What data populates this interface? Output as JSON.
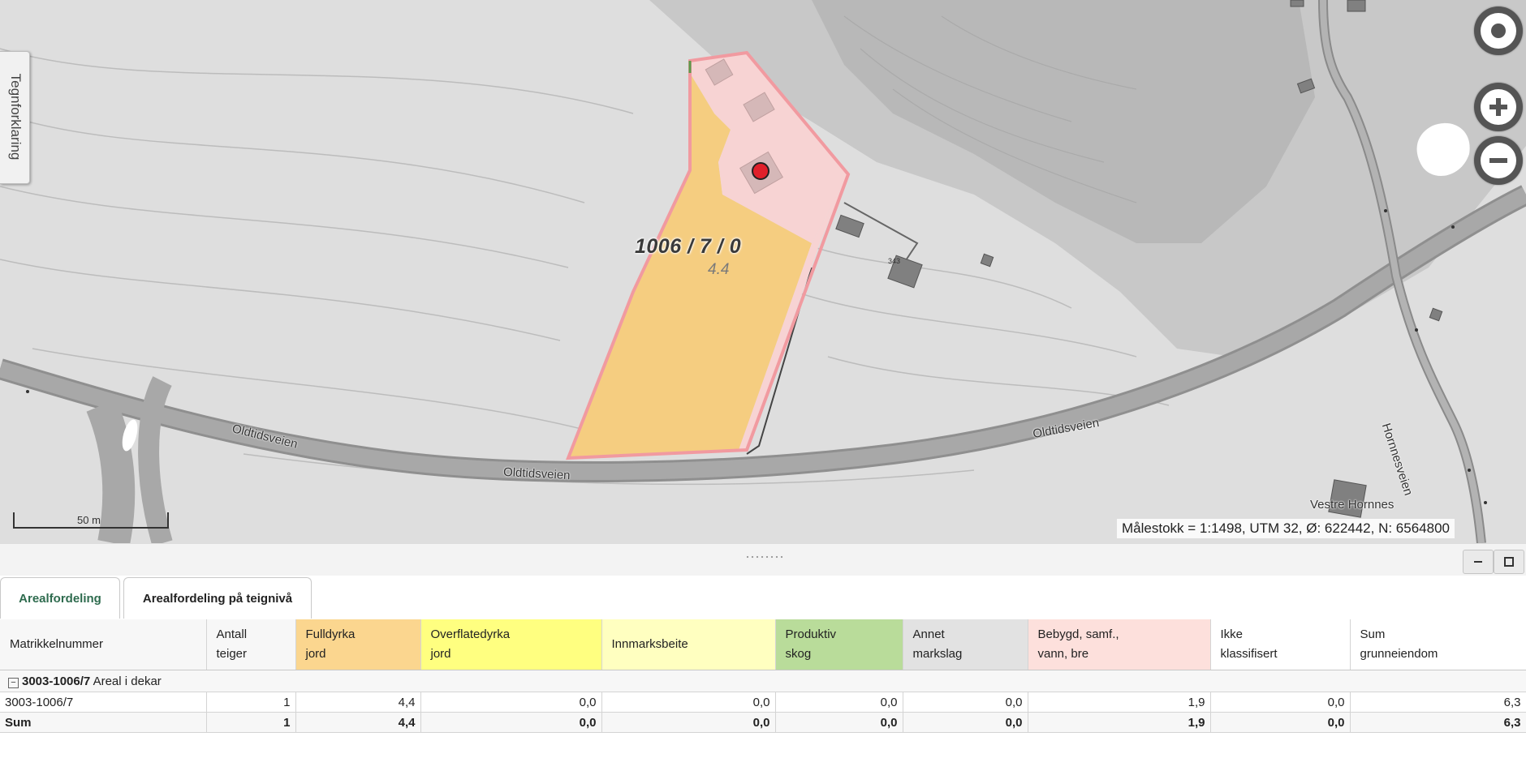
{
  "map": {
    "legend_tab_label": "Tegnforklaring",
    "parcel_label": "1006 / 7 / 0",
    "parcel_area": "4.4",
    "house_number": "343",
    "road_labels": [
      "Oldtidsveien",
      "Oldtidsveien",
      "Oldtidsveien",
      "Hornnesveien"
    ],
    "place_label": "Vestre Hornnes",
    "scale_bar_label": "50 m",
    "status_line": "Målestokk = 1:1498, UTM 32,  Ø:  622442, N: 6564800",
    "controls": {
      "locate_icon": "locate-icon",
      "zoom_in_icon": "plus-icon",
      "zoom_out_icon": "minus-icon"
    },
    "colors": {
      "fulldyrka": "#f5cd80",
      "bebygd": "#f7d3d3",
      "parcel_border": "#f19aa0",
      "marker": "#e0202a"
    }
  },
  "panel": {
    "minimize_icon": "minimize-icon",
    "maximize_icon": "maximize-icon",
    "tabs": [
      "Arealfordeling",
      "Arealfordeling på teignivå"
    ],
    "active_tab": "Arealfordeling",
    "active_tab_color": "#2e6b4e"
  },
  "table": {
    "headers": [
      {
        "line1": "Matrikkelnummer",
        "line2": "",
        "color": "#f7f7f7"
      },
      {
        "line1": "Antall",
        "line2": "teiger",
        "color": "#f7f7f7"
      },
      {
        "line1": "Fulldyrka",
        "line2": "jord",
        "color": "#fbd68f"
      },
      {
        "line1": "Overflatedyrka",
        "line2": "jord",
        "color": "#ffff80"
      },
      {
        "line1": "Innmarksbeite",
        "line2": "",
        "color": "#ffffc0"
      },
      {
        "line1": "Produktiv",
        "line2": "skog",
        "color": "#b9dc9a"
      },
      {
        "line1": "Annet",
        "line2": "markslag",
        "color": "#e2e2e2"
      },
      {
        "line1": "Bebygd, samf.,",
        "line2": "vann, bre",
        "color": "#fde0dc"
      },
      {
        "line1": "Ikke",
        "line2": "klassifisert",
        "color": "#ffffff"
      },
      {
        "line1": "Sum",
        "line2": "grunneiendom",
        "color": "#ffffff"
      }
    ],
    "group": {
      "id": "3003-1006/7",
      "label": "Areal i dekar"
    },
    "rows": [
      [
        "3003-1006/7",
        "1",
        "4,4",
        "0,0",
        "0,0",
        "0,0",
        "0,0",
        "1,9",
        "0,0",
        "6,3"
      ]
    ],
    "sum_row": [
      "Sum",
      "1",
      "4,4",
      "0,0",
      "0,0",
      "0,0",
      "0,0",
      "1,9",
      "0,0",
      "6,3"
    ]
  }
}
